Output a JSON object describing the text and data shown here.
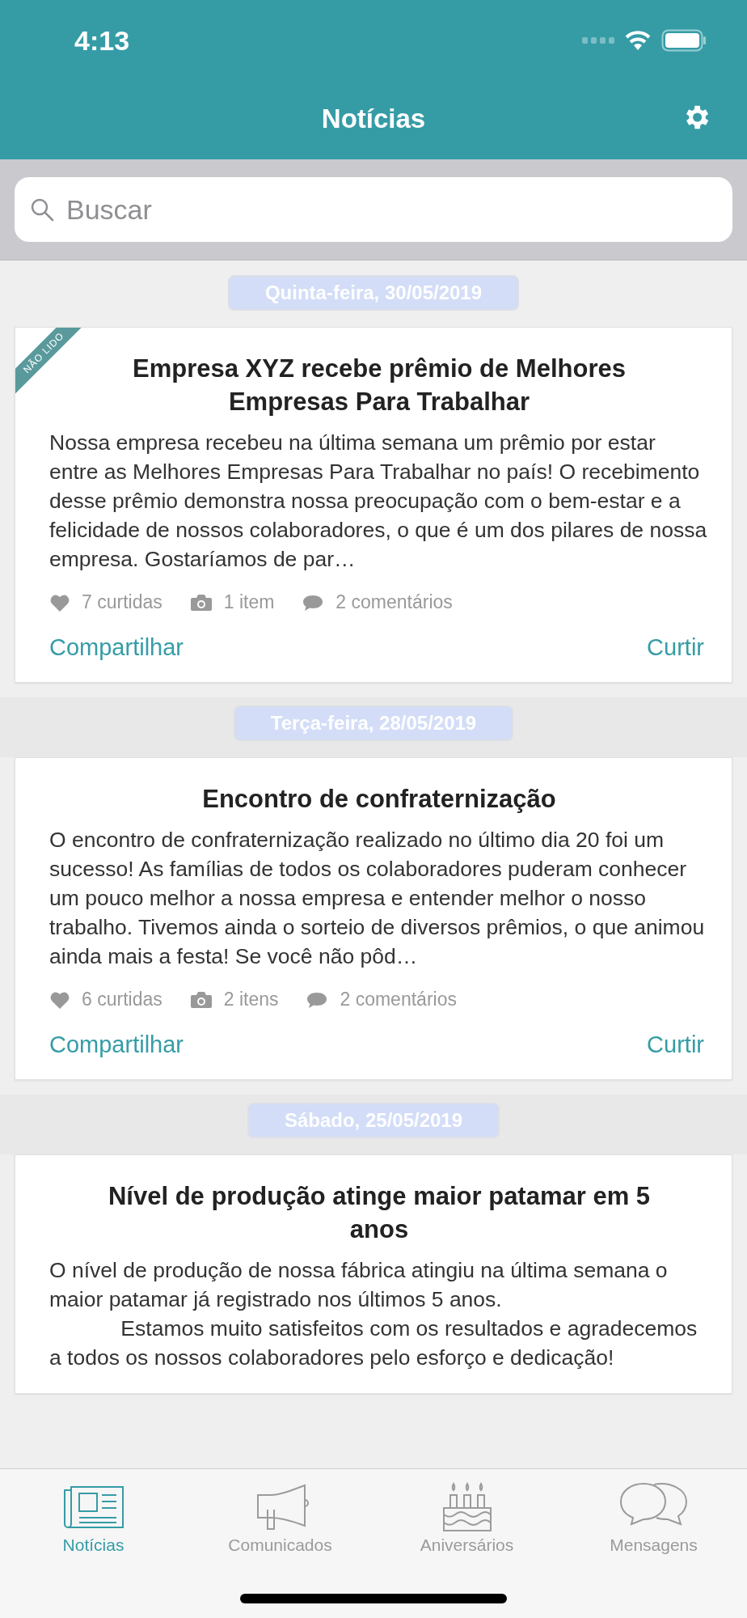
{
  "status_bar": {
    "time": "4:13"
  },
  "nav": {
    "title": "Notícias"
  },
  "search": {
    "placeholder": "Buscar"
  },
  "feed": [
    {
      "date": "Quinta-feira, 30/05/2019",
      "unread": true,
      "unread_label": "NÃO LIDO",
      "title": "Empresa XYZ recebe prêmio de Melhores Empresas Para Trabalhar",
      "body": "Nossa empresa recebeu na última semana um prêmio por estar entre as Melhores Empresas Para Trabalhar no país! O recebimento desse prêmio demonstra nossa preocupação com o bem-estar e a felicidade de nossos colaboradores, o que é um dos pilares de nossa empresa. Gostaríamos de par…",
      "likes": "7 curtidas",
      "items": "1 item",
      "comments": "2 comentários",
      "share": "Compartilhar",
      "like": "Curtir"
    },
    {
      "date": "Terça-feira, 28/05/2019",
      "unread": false,
      "title": "Encontro de confraternização",
      "body": "O encontro de confraternização realizado no último dia 20 foi um sucesso! As famílias de todos os colaboradores puderam conhecer um pouco melhor a nossa empresa e entender melhor o nosso trabalho. Tivemos ainda o sorteio de diversos prêmios, o que animou ainda mais a festa! Se você não pôd…",
      "likes": "6 curtidas",
      "items": "2 itens",
      "comments": "2 comentários",
      "share": "Compartilhar",
      "like": "Curtir"
    },
    {
      "date": "Sábado, 25/05/2019",
      "unread": false,
      "title": "Nível de produção atinge maior patamar em 5 anos",
      "body": "O nível de produção de nossa fábrica atingiu na última semana o maior patamar já registrado nos últimos 5 anos.\n            Estamos muito satisfeitos com os resultados e agradecemos a todos os nossos colaboradores pelo esforço e dedicação!"
    }
  ],
  "tabs": [
    {
      "kind": "news",
      "label": "Notícias",
      "selected": true
    },
    {
      "kind": "announcements",
      "label": "Comunicados",
      "selected": false
    },
    {
      "kind": "birthdays",
      "label": "Aniversários",
      "selected": false
    },
    {
      "kind": "messages",
      "label": "Mensagens",
      "selected": false
    }
  ]
}
